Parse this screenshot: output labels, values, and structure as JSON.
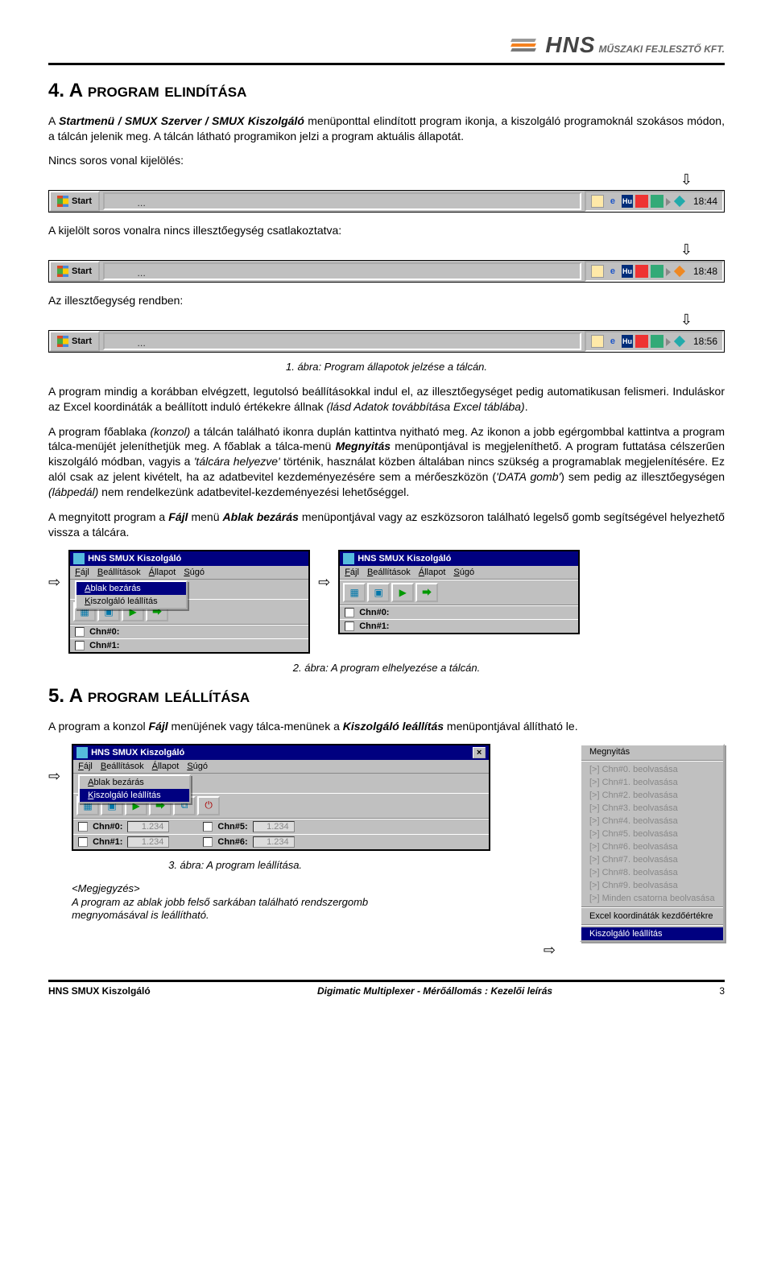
{
  "header": {
    "logo_main": "HNS",
    "logo_sub": "MŰSZAKI FEJLESZTŐ KFT."
  },
  "section4": {
    "title": "4. A program elindítása",
    "p1_a": "A ",
    "p1_b": "Startmenü / SMUX Szerver / SMUX Kiszolgáló",
    "p1_c": " menüponttal elindított program ikonja, a kiszolgáló programoknál szokásos módon, a tálcán jelenik meg. A tálcán látható programikon jelzi a program aktuális állapotát.",
    "label_no_sel": "Nincs soros vonal kijelölés:",
    "label_no_if": "A kijelölt soros vonalra nincs illesztőegység csatlakoztatva:",
    "label_if_ok": "Az illesztőegység rendben:",
    "caption1": "1. ábra: Program állapotok jelzése a tálcán.",
    "p2": "A program mindig a korábban elvégzett, legutolsó beállításokkal indul el, az illesztőegységet pedig automatikusan felismeri. Induláskor az Excel koordináták a beállított induló értékekre állnak ",
    "p2_i": "(lásd Adatok továbbítása Excel táblába)",
    "p2_end": ".",
    "p3_a": "A program főablaka ",
    "p3_b": "(konzol)",
    "p3_c": " a tálcán található ikonra duplán kattintva nyitható meg. Az ikonon a jobb egérgombbal kattintva a program tálca-menüjét jeleníthetjük meg. A főablak a tálca-menü ",
    "p3_open": "Megnyitás",
    "p3_d": " menüpontjával is megjeleníthető. A program futtatása célszerűen kiszolgáló módban, vagyis a ",
    "p3_tray": "'tálcára helyezve'",
    "p3_e": " történik, használat közben általában nincs szükség a programablak megjelenítésére. Ez alól csak az jelent kivételt, ha az adatbevitel kezdeményezésére sem a mérőeszközön (",
    "p3_data": "'DATA gomb'",
    "p3_f": ") sem pedig az illesztőegységen ",
    "p3_g": "(lábpedál)",
    "p3_h": " nem rendelkezünk adatbevitel-kezdeményezési lehetőséggel.",
    "p4_a": "A megnyitott program a ",
    "p4_b": "Fájl",
    "p4_c": " menü ",
    "p4_d": "Ablak bezárás",
    "p4_e": " menüpontjával vagy az eszközsoron található legelső gomb segítségével helyezhető vissza a tálcára.",
    "caption2": "2. ábra: A program elhelyezése a tálcán."
  },
  "section5": {
    "title": "5. A program leállítása",
    "p1_a": "A program a konzol ",
    "p1_b": "Fájl",
    "p1_c": " menüjének vagy tálca-menünek a ",
    "p1_d": "Kiszolgáló leállítás",
    "p1_e": " menüpontjával állítható le.",
    "caption3": "3. ábra: A program leállítása.",
    "note_label": "<Megjegyzés>",
    "note_text": "A program az ablak jobb felső sarkában található rendszergomb megnyomásával is leállítható."
  },
  "taskbars": {
    "start": "Start",
    "dots": "…",
    "hu": "Hu",
    "clock1": "18:44",
    "clock2": "18:48",
    "clock3": "18:56"
  },
  "window": {
    "title": "HNS SMUX Kiszolgáló",
    "menu": {
      "file": "Fájl",
      "settings": "Beállítások",
      "status": "Állapot",
      "help": "Súgó"
    },
    "menu_u": {
      "file": "F",
      "settings": "B",
      "status": "Á",
      "help": "S"
    },
    "file_menu": {
      "close": "Ablak bezárás",
      "stop": "Kiszolgáló leállítás",
      "close_u": "A",
      "stop_u": "K"
    },
    "chn0": "Chn#0:",
    "chn1": "Chn#1:",
    "chn5": "Chn#5:",
    "chn6": "Chn#6:",
    "val": "1.234"
  },
  "ctx": {
    "open": "Megnyitás",
    "items": [
      "[>] Chn#0. beolvasása",
      "[>] Chn#1. beolvasása",
      "[>] Chn#2. beolvasása",
      "[>] Chn#3. beolvasása",
      "[>] Chn#4. beolvasása",
      "[>] Chn#5. beolvasása",
      "[>] Chn#6. beolvasása",
      "[>] Chn#7. beolvasása",
      "[>] Chn#8. beolvasása",
      "[>] Chn#9. beolvasása",
      "[>] Minden csatorna beolvasása"
    ],
    "excel": "Excel koordináták kezdőértékre",
    "stop": "Kiszolgáló leállítás"
  },
  "footer": {
    "left": "HNS SMUX Kiszolgáló",
    "center": "Digimatic Multiplexer - Mérőállomás : Kezelői leírás",
    "right": "3"
  },
  "glyph": {
    "down": "⇩",
    "right": "⇨"
  }
}
